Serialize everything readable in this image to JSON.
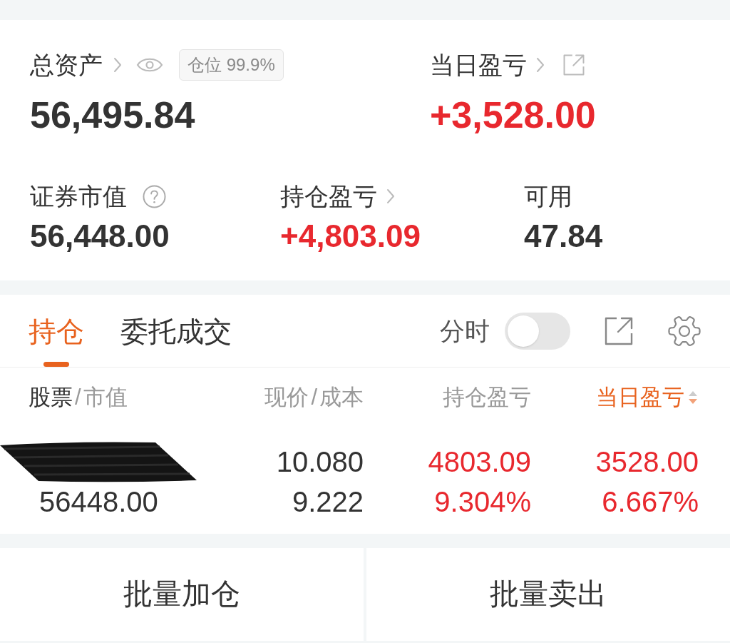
{
  "account_summary": {
    "total_assets": {
      "label": "总资产",
      "position_badge": "仓位 99.9%",
      "value": "56,495.84",
      "positive": false
    },
    "daily_pnl": {
      "label": "当日盈亏",
      "value": "+3,528.00",
      "positive": true
    },
    "stats": [
      {
        "kind": "help",
        "label": "证券市值",
        "value": "56,448.00",
        "positive": false
      },
      {
        "kind": "link",
        "label": "持仓盈亏",
        "value": "+4,803.09",
        "positive": true
      },
      {
        "kind": "plain",
        "label": "可用",
        "value": "47.84",
        "positive": false
      }
    ]
  },
  "holdings_panel": {
    "tabs": [
      {
        "label": "持仓",
        "selected": true
      },
      {
        "label": "委托成交",
        "selected": false
      }
    ],
    "time_share": {
      "label": "分时",
      "on": false
    },
    "columns": [
      {
        "primary": "股票",
        "separator": "/",
        "secondary": "市值",
        "emphasis": true,
        "sorted": false
      },
      {
        "primary": "现价",
        "separator": "/",
        "secondary": "成本",
        "emphasis": false,
        "sorted": false
      },
      {
        "primary": "持仓盈亏",
        "emphasis": false,
        "sorted": false
      },
      {
        "primary": "当日盈亏",
        "emphasis": false,
        "sorted": true
      }
    ],
    "rows": [
      {
        "market_value": "56448.00",
        "price": "10.080",
        "cost": "9.222",
        "pnl": "4803.09",
        "pnl_pct": "9.304%",
        "pnl_positive": true,
        "day_pnl": "3528.00",
        "day_pnl_pct": "6.667%",
        "day_positive": true
      }
    ]
  },
  "actions": [
    {
      "label": "批量加仓"
    },
    {
      "label": "批量卖出"
    }
  ]
}
